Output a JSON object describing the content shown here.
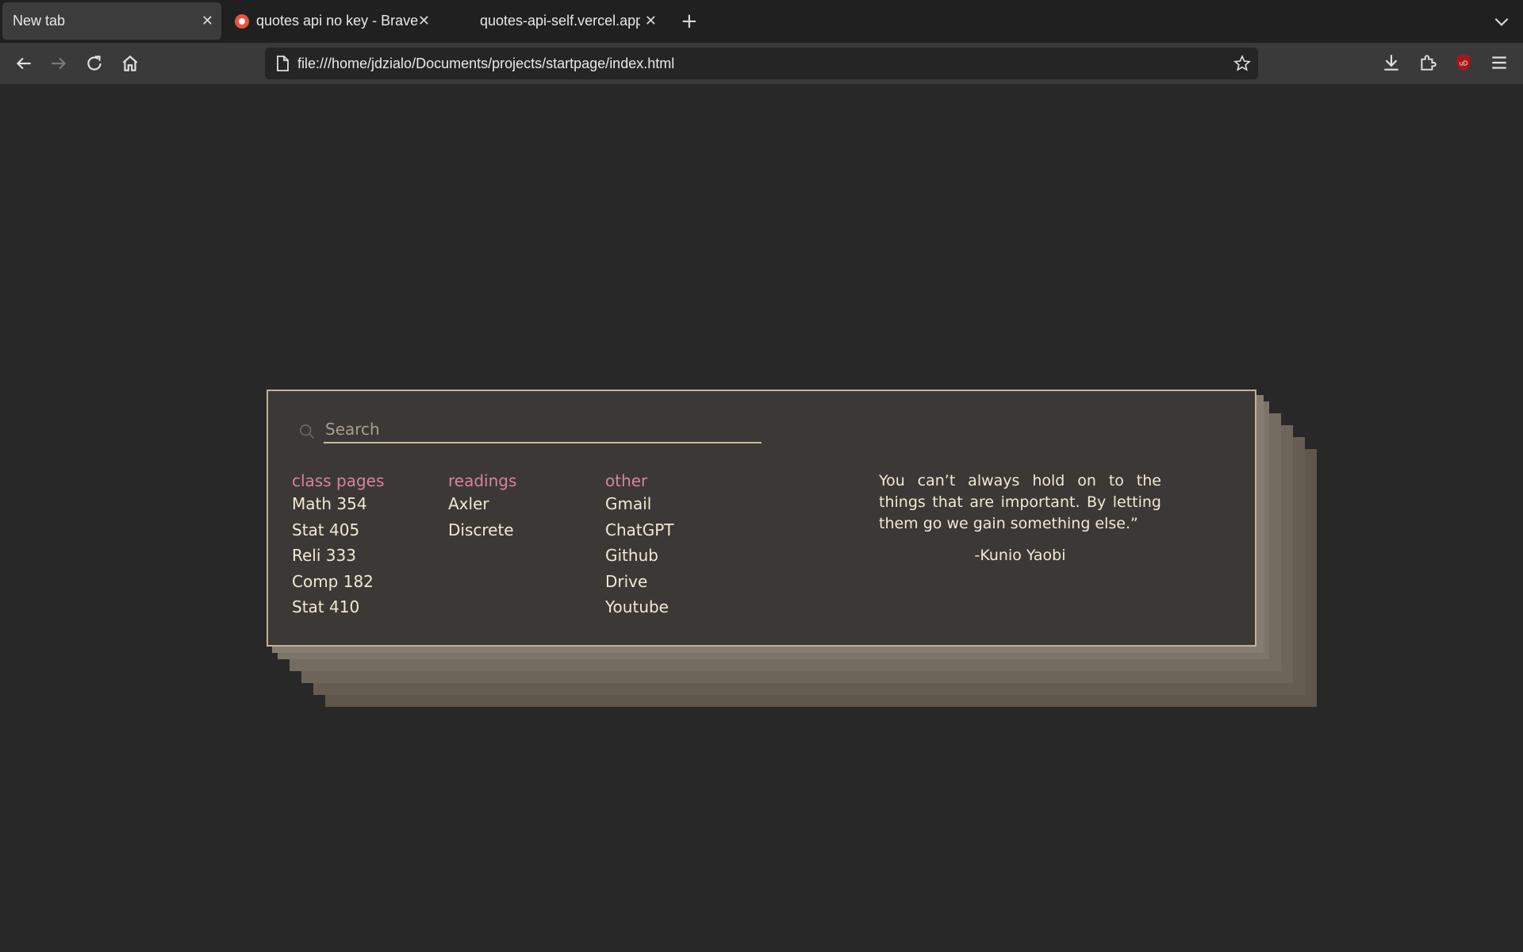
{
  "browser": {
    "tabs": [
      {
        "title": "New tab",
        "active": true
      },
      {
        "title": "quotes api no key - Brave S",
        "active": false
      },
      {
        "title": "quotes-api-self.vercel.app/",
        "active": false
      }
    ],
    "url": "file:///home/jdzialo/Documents/projects/startpage/index.html",
    "icons": [
      "back-icon",
      "forward-icon",
      "reload-icon",
      "home-icon",
      "page-icon",
      "bookmark-star-icon",
      "download-icon",
      "extensions-icon",
      "ublock-icon",
      "menu-icon",
      "tab-list-icon",
      "new-tab-icon",
      "close-icon"
    ]
  },
  "startpage": {
    "search": {
      "placeholder": "Search"
    },
    "columns": [
      {
        "heading": "class pages",
        "links": [
          "Math 354",
          "Stat 405",
          "Reli 333",
          "Comp 182",
          "Stat 410"
        ]
      },
      {
        "heading": "readings",
        "links": [
          "Axler",
          "Discrete"
        ]
      },
      {
        "heading": "other",
        "links": [
          "Gmail",
          "ChatGPT",
          "Github",
          "Drive",
          "Youtube"
        ]
      }
    ],
    "quote": {
      "text": "You can’t always hold on to the things that are important. By letting them go we gain something else.”",
      "author": "-Kunio Yaobi"
    }
  },
  "colors": {
    "background": "#282828",
    "card": "#3c3835",
    "card_border": "#c0b39a",
    "heading_accent": "#d3869b",
    "text": "#f2e8d5",
    "stack_layers": [
      "#857d72",
      "#7d7569",
      "#756c61",
      "#6d6559",
      "#665d52",
      "#5f564c"
    ]
  }
}
